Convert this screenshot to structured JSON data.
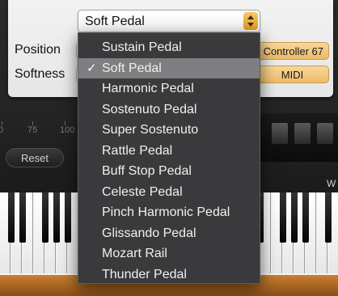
{
  "dropdown": {
    "selected_value": "Soft Pedal"
  },
  "panel": {
    "position_label": "Position",
    "softness_label": "Softness",
    "controller_button": "Controller 67",
    "midi_button": "MIDI"
  },
  "scale": {
    "tick_0": "0",
    "tick_75": "75",
    "tick_100": "100"
  },
  "reset_button": "Reset",
  "keyboard_letter": "W",
  "menu": {
    "check_mark": "✓",
    "items": [
      {
        "label": "Sustain Pedal",
        "selected": false
      },
      {
        "label": "Soft Pedal",
        "selected": true
      },
      {
        "label": "Harmonic Pedal",
        "selected": false
      },
      {
        "label": "Sostenuto Pedal",
        "selected": false
      },
      {
        "label": "Super Sostenuto",
        "selected": false
      },
      {
        "label": "Rattle Pedal",
        "selected": false
      },
      {
        "label": "Buff Stop Pedal",
        "selected": false
      },
      {
        "label": "Celeste Pedal",
        "selected": false
      },
      {
        "label": "Pinch Harmonic Pedal",
        "selected": false
      },
      {
        "label": "Glissando Pedal",
        "selected": false
      },
      {
        "label": "Mozart Rail",
        "selected": false
      },
      {
        "label": "Thunder Pedal",
        "selected": false
      }
    ]
  },
  "colors": {
    "accent_orange": "#ecbb67",
    "menu_background": "#3a3a3c",
    "menu_highlight": "#7f7f82"
  }
}
